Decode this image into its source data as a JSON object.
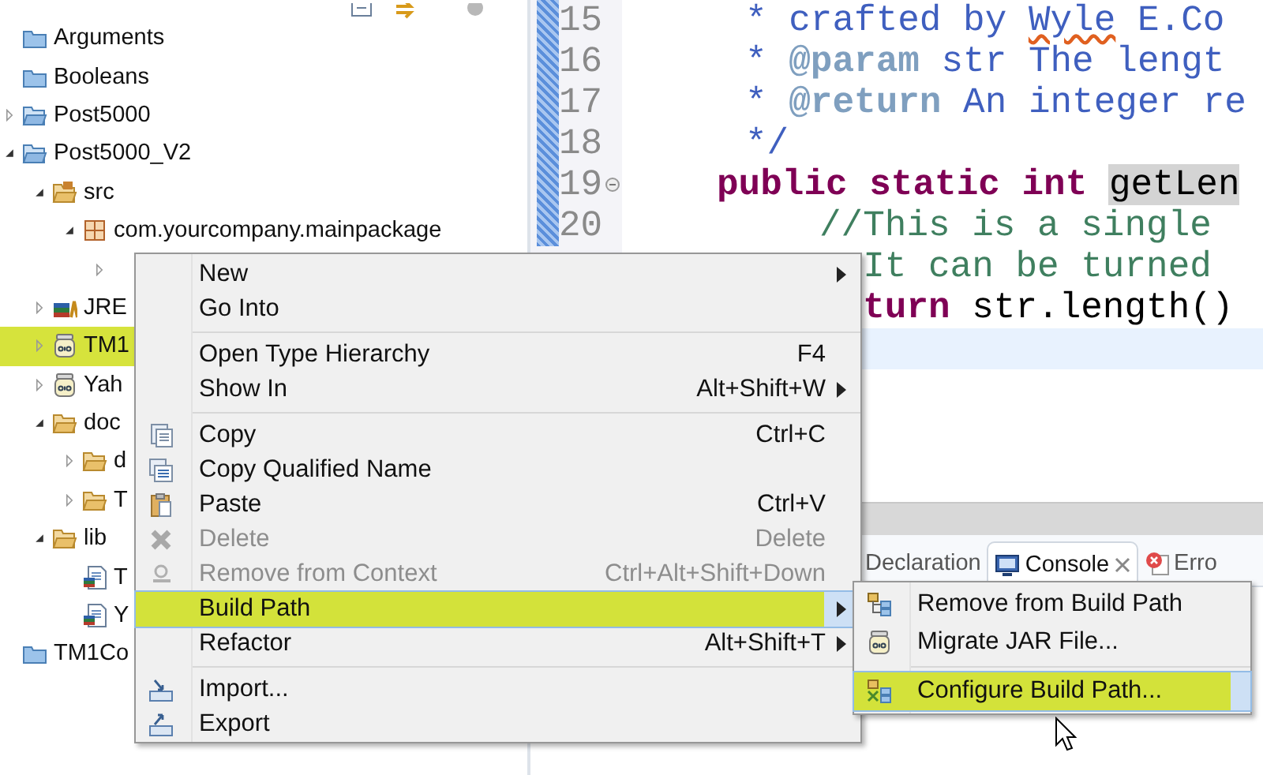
{
  "tree": {
    "items": [
      {
        "label": "Arguments",
        "kind": "project",
        "selected": false
      },
      {
        "label": "Booleans",
        "kind": "project",
        "selected": false
      },
      {
        "label": "Post5000",
        "kind": "open-project",
        "expanded": false,
        "selected": false
      },
      {
        "label": "Post5000_V2",
        "kind": "open-project",
        "expanded": true,
        "selected": false,
        "children": [
          {
            "label": "src",
            "kind": "source-folder",
            "expanded": true,
            "selected": false,
            "children": [
              {
                "label": "com.yourcompany.mainpackage",
                "kind": "package",
                "expanded": true,
                "selected": false,
                "children": [
                  {
                    "expanded": false,
                    "selected": false
                  }
                ]
              }
            ]
          },
          {
            "label": "JRE",
            "kind": "library",
            "expanded": false,
            "selected": false
          },
          {
            "label": "TM1",
            "kind": "jar",
            "expanded": false,
            "selected": true
          },
          {
            "label": "Yah",
            "kind": "jar",
            "expanded": false,
            "selected": false
          },
          {
            "label": "doc",
            "kind": "folder",
            "expanded": true,
            "selected": false,
            "children": [
              {
                "label": "d",
                "kind": "folder",
                "expanded": false,
                "selected": false
              },
              {
                "label": "T",
                "kind": "folder",
                "expanded": false,
                "selected": false
              }
            ]
          },
          {
            "label": "lib",
            "kind": "folder",
            "expanded": true,
            "selected": false,
            "children": [
              {
                "label": "T",
                "kind": "file",
                "selected": false
              },
              {
                "label": "Y",
                "kind": "file",
                "selected": false
              }
            ]
          }
        ]
      },
      {
        "label": "TM1Co",
        "kind": "project",
        "selected": false
      }
    ]
  },
  "editor": {
    "lines": [
      {
        "number": "15",
        "kind": "javadoc",
        "foldable": false,
        "segments": [
          {
            "text": "* crafted by ",
            "kind": "doc"
          },
          {
            "text": "Wyle",
            "kind": "misspelled"
          },
          {
            "text": " E.Co",
            "kind": "doc"
          }
        ]
      },
      {
        "number": "16",
        "kind": "javadoc",
        "foldable": false,
        "segments": [
          {
            "text": "* ",
            "kind": "doc"
          },
          {
            "text": "@param",
            "kind": "tag"
          },
          {
            "text": " str The lengt",
            "kind": "doc"
          }
        ]
      },
      {
        "number": "17",
        "kind": "javadoc",
        "foldable": false,
        "segments": [
          {
            "text": "* ",
            "kind": "doc"
          },
          {
            "text": "@return",
            "kind": "tag"
          },
          {
            "text": " An integer re",
            "kind": "doc"
          }
        ]
      },
      {
        "number": "18",
        "kind": "javadoc",
        "foldable": false,
        "segments": [
          {
            "text": "*/",
            "kind": "doc"
          }
        ]
      },
      {
        "number": "19",
        "kind": "method",
        "foldable": true,
        "segments": [
          {
            "text": "public static int ",
            "kind": "keyword"
          },
          {
            "text": "getLen",
            "kind": "highlight"
          }
        ]
      },
      {
        "number": "20",
        "kind": "comment",
        "foldable": false,
        "segments": [
          {
            "text": "//This is a single",
            "kind": "comment"
          }
        ]
      },
      {
        "kind": "comment",
        "segments": [
          {
            "text": "It can be turned",
            "kind": "comment"
          }
        ]
      },
      {
        "kind": "statement",
        "segments": [
          {
            "text": "turn",
            "kind": "keyword"
          },
          {
            "text": " str.length()",
            "kind": "plain"
          }
        ]
      }
    ]
  },
  "bottom_panel": {
    "tabs": [
      {
        "label": "Declaration",
        "kind": "declaration",
        "selected": false
      },
      {
        "label": "Console",
        "kind": "console",
        "selected": true
      },
      {
        "label": "Erro",
        "kind": "error",
        "selected": false
      }
    ]
  },
  "context_menu": {
    "groups": [
      [
        {
          "label": "New",
          "kind": "command",
          "disabled": false,
          "selected": false,
          "submenu": true
        },
        {
          "label": "Go Into",
          "kind": "command",
          "disabled": false,
          "selected": false,
          "submenu": false
        }
      ],
      [
        {
          "label": "Open Type Hierarchy",
          "shortcut": "F4",
          "kind": "command",
          "disabled": false,
          "selected": false,
          "submenu": false
        },
        {
          "label": "Show In",
          "shortcut": "Alt+Shift+W",
          "kind": "command",
          "disabled": false,
          "selected": false,
          "submenu": true
        }
      ],
      [
        {
          "label": "Copy",
          "shortcut": "Ctrl+C",
          "kind": "copy",
          "disabled": false,
          "selected": false,
          "submenu": false
        },
        {
          "label": "Copy Qualified Name",
          "kind": "copy-name",
          "disabled": false,
          "selected": false,
          "submenu": false
        },
        {
          "label": "Paste",
          "shortcut": "Ctrl+V",
          "kind": "paste",
          "disabled": false,
          "selected": false,
          "submenu": false
        },
        {
          "label": "Delete",
          "shortcut": "Delete",
          "kind": "delete",
          "disabled": true,
          "selected": false,
          "submenu": false
        },
        {
          "label": "Remove from Context",
          "shortcut": "Ctrl+Alt+Shift+Down",
          "kind": "remove",
          "disabled": true,
          "selected": false,
          "submenu": false
        },
        {
          "label": "Build Path",
          "kind": "command",
          "disabled": false,
          "selected": true,
          "submenu": true
        },
        {
          "label": "Refactor",
          "shortcut": "Alt+Shift+T",
          "kind": "command",
          "disabled": false,
          "selected": false,
          "submenu": true
        }
      ],
      [
        {
          "label": "Import...",
          "kind": "import",
          "disabled": false,
          "selected": false,
          "submenu": false
        },
        {
          "label": "Export",
          "kind": "export",
          "disabled": false,
          "selected": false,
          "submenu": false
        }
      ]
    ]
  },
  "submenu": {
    "groups": [
      [
        {
          "label": "Remove from Build Path",
          "kind": "hierarchy",
          "selected": false
        },
        {
          "label": "Migrate JAR File...",
          "kind": "jar",
          "selected": false
        }
      ],
      [
        {
          "label": "Configure Build Path...",
          "kind": "build-path",
          "selected": true
        }
      ]
    ]
  }
}
